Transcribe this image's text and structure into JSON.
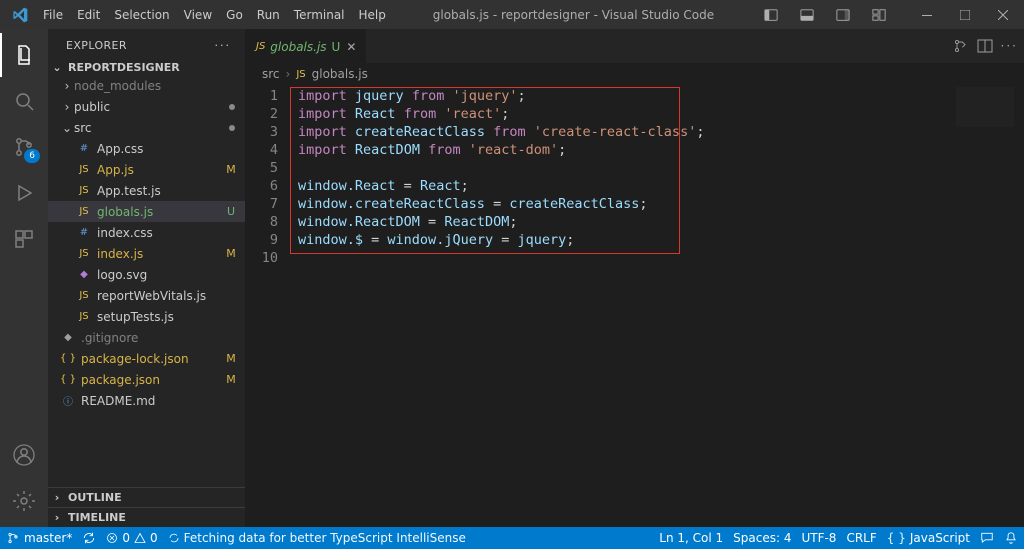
{
  "title": "globals.js - reportdesigner - Visual Studio Code",
  "menu": {
    "file": "File",
    "edit": "Edit",
    "selection": "Selection",
    "view": "View",
    "go": "Go",
    "run": "Run",
    "terminal": "Terminal",
    "help": "Help"
  },
  "sidebar": {
    "header": "EXPLORER",
    "project": "REPORTDESIGNER",
    "sections": {
      "outline": "OUTLINE",
      "timeline": "TIMELINE"
    },
    "tree": {
      "node_modules": "node_modules",
      "public": "public",
      "src": "src",
      "app_css": "App.css",
      "app_js": "App.js",
      "app_test_js": "App.test.js",
      "globals_js": "globals.js",
      "index_css": "index.css",
      "index_js": "index.js",
      "logo_svg": "logo.svg",
      "report_web_vitals": "reportWebVitals.js",
      "setup_tests": "setupTests.js",
      "gitignore": ".gitignore",
      "package_lock": "package-lock.json",
      "package_json": "package.json",
      "readme": "README.md"
    },
    "status": {
      "M": "M",
      "U": "U"
    }
  },
  "activity": {
    "scm_badge": "6"
  },
  "tab": {
    "icon": "JS",
    "name": "globals.js",
    "suffix": "U"
  },
  "breadcrumbs": {
    "src": "src",
    "icon": "JS",
    "file": "globals.js"
  },
  "code": {
    "lines": [
      {
        "pre": "",
        "k": "import",
        "sp": " ",
        "i": "jquery",
        "sp2": " ",
        "k2": "from",
        "sp3": " ",
        "s": "'jquery'",
        "t": ";"
      },
      {
        "pre": "",
        "k": "import",
        "sp": " ",
        "i": "React",
        "sp2": " ",
        "k2": "from",
        "sp3": " ",
        "s": "'react'",
        "t": ";"
      },
      {
        "pre": "",
        "k": "import",
        "sp": " ",
        "i": "createReactClass",
        "sp2": " ",
        "k2": "from",
        "sp3": " ",
        "s": "'create-react-class'",
        "t": ";"
      },
      {
        "pre": "",
        "k": "import",
        "sp": " ",
        "i": "ReactDOM",
        "sp2": " ",
        "k2": "from",
        "sp3": " ",
        "s": "'react-dom'",
        "t": ";"
      },
      {
        "blank": true
      },
      {
        "lhs": "window.React",
        "op": " = ",
        "rhs": "React",
        "t": ";"
      },
      {
        "lhs": "window.createReactClass",
        "op": " = ",
        "rhs": "createReactClass",
        "t": ";"
      },
      {
        "lhs": "window.ReactDOM",
        "op": " = ",
        "rhs": "ReactDOM",
        "t": ";"
      },
      {
        "lhs": "window.$",
        "op": " = ",
        "mid": "window.jQuery",
        "op2": " = ",
        "rhs": "jquery",
        "t": ";"
      },
      {
        "blank": true
      }
    ]
  },
  "status": {
    "branch": "master*",
    "errors": "0",
    "warnings": "0",
    "message": "Fetching data for better TypeScript IntelliSense",
    "ln_col": "Ln 1, Col 1",
    "spaces": "Spaces: 4",
    "encoding": "UTF-8",
    "eol": "CRLF",
    "language": "JavaScript"
  }
}
